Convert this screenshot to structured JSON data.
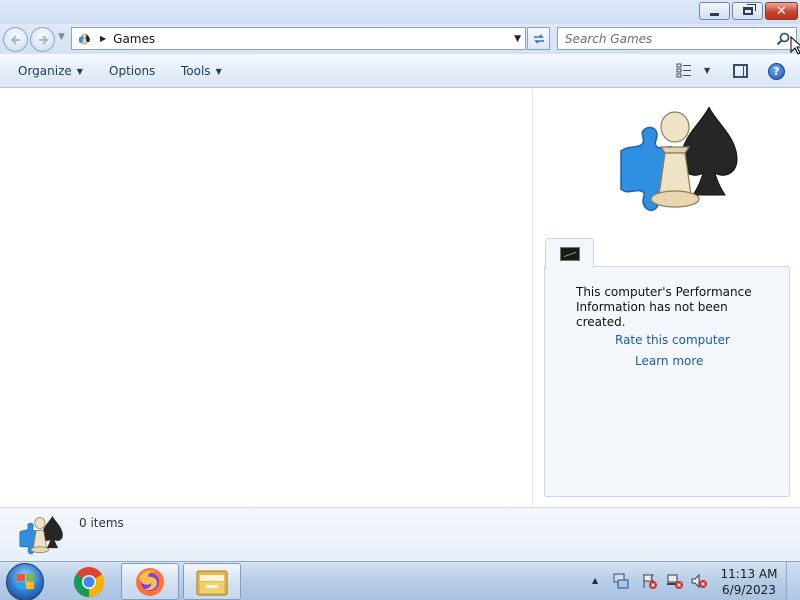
{
  "window": {
    "controls": {
      "minimize_icon": "minimize-icon",
      "maximize_icon": "restore-icon",
      "close_label": "✕"
    }
  },
  "navigation": {
    "back_icon": "back-arrow-icon",
    "forward_icon": "forward-arrow-icon",
    "address_path": "Games",
    "search_placeholder": "Search Games",
    "search_value": ""
  },
  "command_bar": {
    "organize_label": "Organize",
    "options_label": "Options",
    "tools_label": "Tools",
    "help_label": "?"
  },
  "preview_pane": {
    "performance_message": "This computer's Performance Information has not been created.",
    "rate_link": "Rate this computer",
    "learn_link": "Learn more"
  },
  "details_pane": {
    "item_count": "0 items"
  },
  "taskbar": {
    "pinned": [
      {
        "name": "chrome",
        "icon": "chrome-icon"
      },
      {
        "name": "firefox",
        "icon": "firefox-icon"
      },
      {
        "name": "file-explorer",
        "icon": "folder-icon",
        "active": true
      }
    ],
    "clock": {
      "time": "11:13 AM",
      "date": "6/9/2023"
    }
  },
  "colors": {
    "link": "#1f5aa6",
    "command_text": "#1e395b",
    "close_button": "#c9452f",
    "taskbar": "#b9cfe7"
  }
}
